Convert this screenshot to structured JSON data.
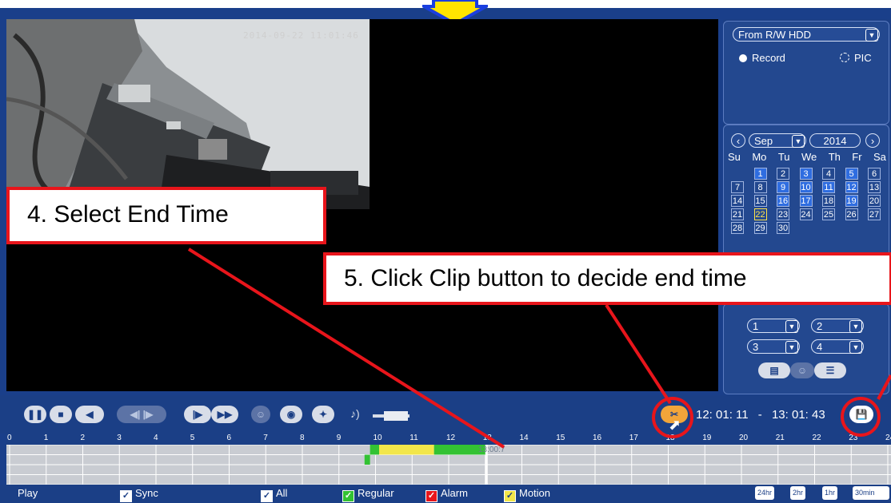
{
  "camera": {
    "timestamp": "2014-09-22 11:01:46"
  },
  "source": {
    "selected": "From R/W HDD"
  },
  "mode": {
    "record_label": "Record",
    "pic_label": "PIC",
    "record_selected": true
  },
  "calendar": {
    "month": "Sep",
    "year": "2014",
    "weekdays": [
      "Su",
      "Mo",
      "Tu",
      "We",
      "Th",
      "Fr",
      "Sa"
    ],
    "weeks": [
      [
        "",
        "1",
        "2",
        "3",
        "4",
        "5",
        "6"
      ],
      [
        "7",
        "8",
        "9",
        "10",
        "11",
        "12",
        "13"
      ],
      [
        "14",
        "15",
        "16",
        "17",
        "18",
        "19",
        "20"
      ],
      [
        "21",
        "22",
        "23",
        "24",
        "25",
        "26",
        "27"
      ],
      [
        "28",
        "29",
        "30",
        "",
        "",
        "",
        ""
      ]
    ],
    "recorded_days": [
      "1",
      "3",
      "5",
      "9",
      "10",
      "11",
      "12",
      "16",
      "17",
      "19"
    ],
    "selected_day": "22"
  },
  "channels": [
    "1",
    "2",
    "3",
    "4"
  ],
  "clip": {
    "start": "12: 01: 11",
    "separator": "-",
    "end": "13: 01: 43"
  },
  "timeline": {
    "hours": [
      "0",
      "1",
      "2",
      "3",
      "4",
      "5",
      "6",
      "7",
      "8",
      "9",
      "10",
      "11",
      "12",
      "13",
      "14",
      "15",
      "16",
      "17",
      "18",
      "19",
      "20",
      "21",
      "22",
      "23",
      "24"
    ],
    "cursor_label": "13:00:7"
  },
  "legend": {
    "play": "Play",
    "sync": "Sync",
    "all": "All",
    "regular": "Regular",
    "alarm": "Alarm",
    "motion": "Motion",
    "colors": {
      "regular": "#33c233",
      "alarm": "#e8151b",
      "motion": "#f2e64a"
    }
  },
  "zoom": [
    "24hr",
    "2hr",
    "1hr",
    "30min"
  ],
  "annotations": {
    "step4": "4. Select  End Time",
    "step5": "5. Click Clip button to decide end time"
  }
}
